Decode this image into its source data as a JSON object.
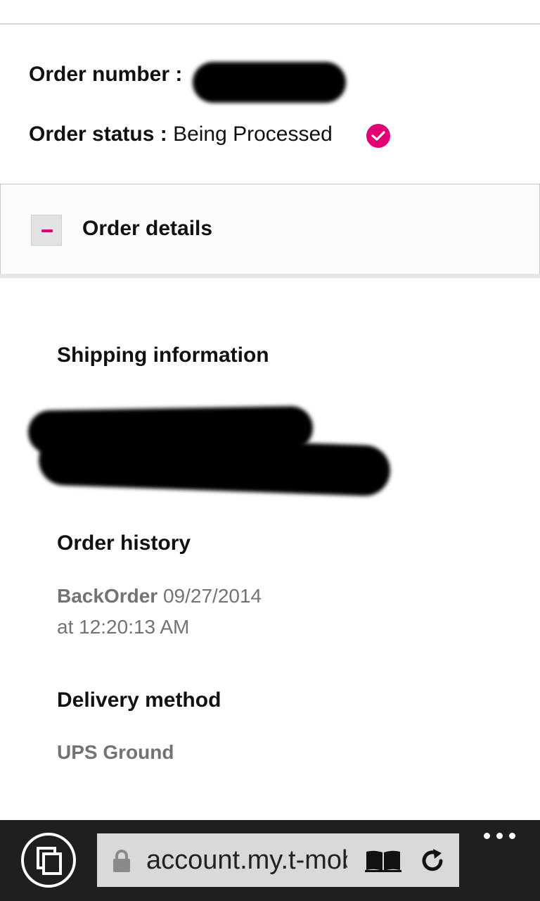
{
  "order": {
    "number_label": "Order number :",
    "status_label": "Order status :",
    "status_value": "Being Processed"
  },
  "details": {
    "title": "Order details",
    "shipping_heading": "Shipping information",
    "history_heading": "Order history",
    "history_event": "BackOrder",
    "history_date": "09/27/2014",
    "history_time": "at 12:20:13 AM",
    "delivery_heading": "Delivery method",
    "delivery_value": "UPS Ground"
  },
  "browser": {
    "url": "account.my.t-mobile.com",
    "icons": [
      "tabs-icon",
      "lock-icon",
      "reading-view-icon",
      "refresh-icon",
      "more-icon"
    ]
  },
  "colors": {
    "accent": "#e20074",
    "muted_text": "#737373",
    "bar_bg": "#1f1f1f",
    "url_bg": "#d9d9d9"
  }
}
